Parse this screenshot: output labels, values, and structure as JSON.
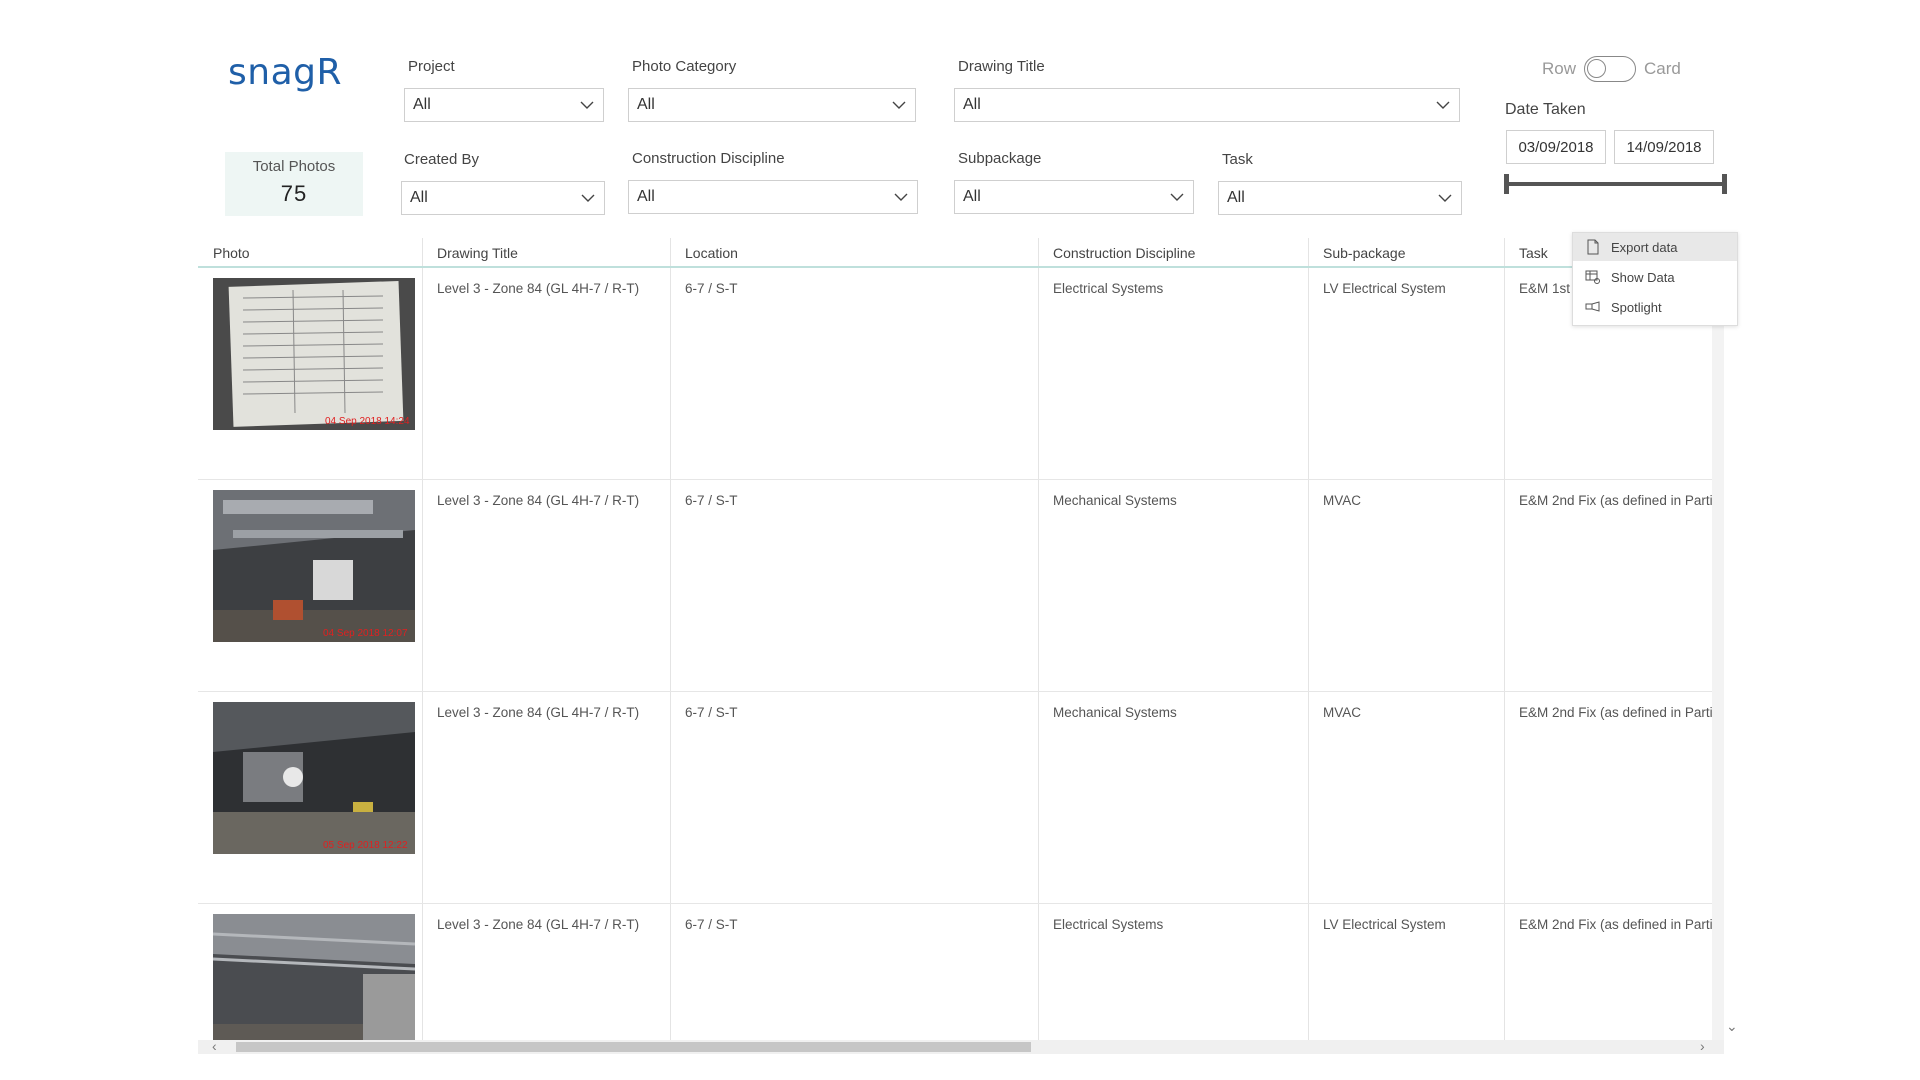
{
  "logo": {
    "text": "snagR"
  },
  "total": {
    "label": "Total Photos",
    "value": "75"
  },
  "filters": {
    "project": {
      "label": "Project",
      "value": "All"
    },
    "photo_category": {
      "label": "Photo Category",
      "value": "All"
    },
    "drawing_title": {
      "label": "Drawing Title",
      "value": "All"
    },
    "created_by": {
      "label": "Created By",
      "value": "All"
    },
    "construction_discipline": {
      "label": "Construction Discipline",
      "value": "All"
    },
    "subpackage": {
      "label": "Subpackage",
      "value": "All"
    },
    "task": {
      "label": "Task",
      "value": "All"
    }
  },
  "view_toggle": {
    "left_label": "Row",
    "right_label": "Card"
  },
  "date_taken": {
    "label": "Date Taken",
    "start": "03/09/2018",
    "end": "14/09/2018"
  },
  "table": {
    "headers": [
      "Photo",
      "Drawing Title",
      "Location",
      "Construction Discipline",
      "Sub-package",
      "Task"
    ],
    "rows": [
      {
        "photo_stamp": "04 Sep 2018 14:24",
        "drawing_title": "Level 3 - Zone 84 (GL 4H-7 / R-T)",
        "location": "6-7 / S-T",
        "discipline": "Electrical Systems",
        "subpackage": "LV Electrical System",
        "task": "E&M 1st"
      },
      {
        "photo_stamp": "04 Sep 2018 12:07",
        "drawing_title": "Level 3 - Zone 84 (GL 4H-7 / R-T)",
        "location": "6-7 / S-T",
        "discipline": "Mechanical Systems",
        "subpackage": "MVAC",
        "task": "E&M 2nd Fix (as defined in Parti"
      },
      {
        "photo_stamp": "05 Sep 2018 12:22",
        "drawing_title": "Level 3 - Zone 84 (GL 4H-7 / R-T)",
        "location": "6-7 / S-T",
        "discipline": "Mechanical Systems",
        "subpackage": "MVAC",
        "task": "E&M 2nd Fix (as defined in Parti"
      },
      {
        "photo_stamp": "",
        "drawing_title": "Level 3 - Zone 84 (GL 4H-7 / R-T)",
        "location": "6-7 / S-T",
        "discipline": "Electrical Systems",
        "subpackage": "LV Electrical System",
        "task": "E&M 2nd Fix (as defined in Parti"
      }
    ]
  },
  "context_menu": {
    "items": [
      {
        "label": "Export data",
        "icon": "document-icon"
      },
      {
        "label": "Show Data",
        "icon": "table-view-icon"
      },
      {
        "label": "Spotlight",
        "icon": "spotlight-icon"
      }
    ]
  },
  "colors": {
    "accent": "#1f5fa8",
    "card_bg": "#eef6f4",
    "header_rule": "#bfe0dc"
  }
}
